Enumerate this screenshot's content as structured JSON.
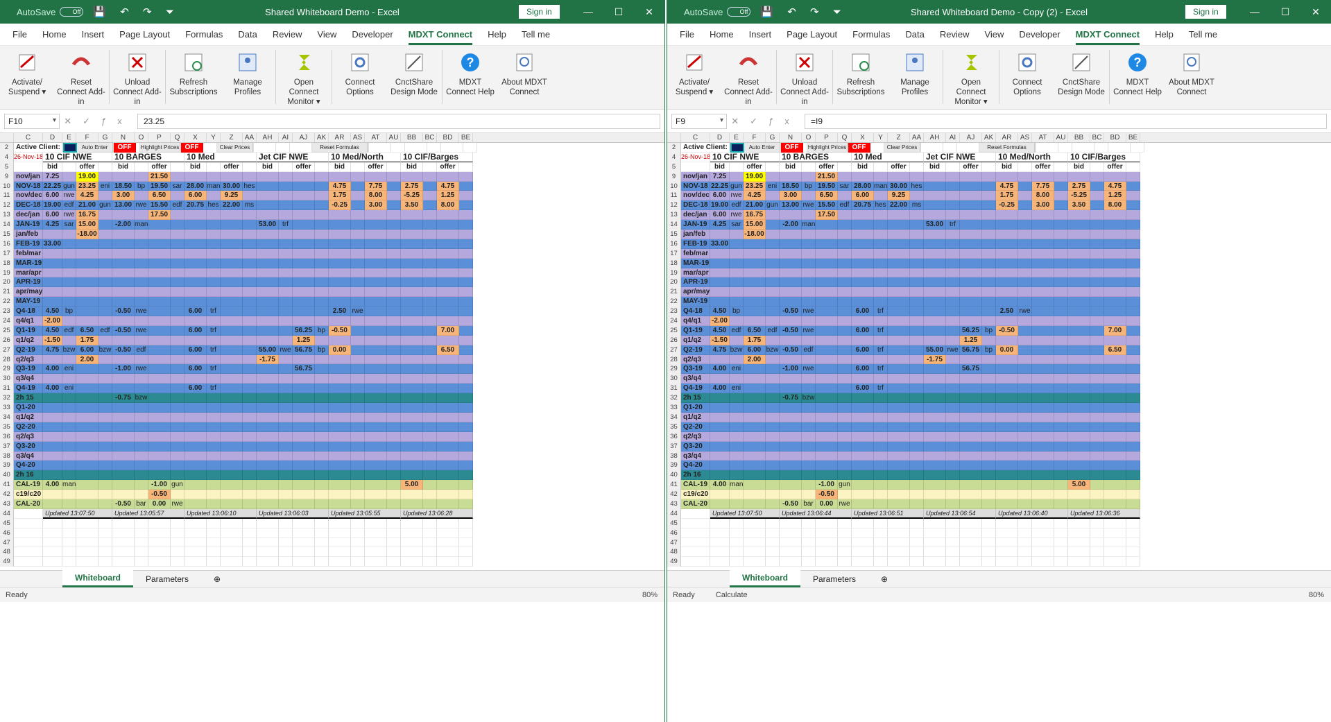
{
  "left": {
    "autosave": "AutoSave",
    "toggle": "Off",
    "title": "Shared Whiteboard Demo  -  Excel",
    "signin": "Sign in",
    "menu": [
      "File",
      "Home",
      "Insert",
      "Page Layout",
      "Formulas",
      "Data",
      "Review",
      "View",
      "Developer",
      "MDXT Connect",
      "Help",
      "Tell me"
    ],
    "namebox": "F10",
    "formula": "23.25",
    "status": "Ready",
    "zoom": "80%"
  },
  "right": {
    "autosave": "AutoSave",
    "toggle": "Off",
    "title": "Shared Whiteboard Demo - Copy (2)  -  Excel",
    "signin": "Sign in",
    "menu": [
      "File",
      "Home",
      "Insert",
      "Page Layout",
      "Formulas",
      "Data",
      "Review",
      "View",
      "Developer",
      "MDXT Connect",
      "Help",
      "Tell me"
    ],
    "namebox": "F9",
    "formula": "=I9",
    "status": "Ready",
    "status2": "Calculate",
    "zoom": "80%"
  },
  "ribbon": [
    {
      "label": "Activate/ Suspend ▾",
      "icon": "activate-icon"
    },
    {
      "label": "Reset Connect Add-in",
      "icon": "reset-icon"
    },
    {
      "label": "Unload Connect Add-in",
      "icon": "unload-icon"
    },
    {
      "label": "Refresh Subscriptions",
      "icon": "refresh-icon"
    },
    {
      "label": "Manage Profiles",
      "icon": "profiles-icon"
    },
    {
      "label": "Open Connect Monitor ▾",
      "icon": "monitor-icon"
    },
    {
      "label": "Connect Options",
      "icon": "options-icon"
    },
    {
      "label": "CnctShare Design Mode",
      "icon": "design-icon"
    },
    {
      "label": "MDXT Connect Help",
      "icon": "help-icon"
    },
    {
      "label": "About MDXT Connect",
      "icon": "about-icon"
    }
  ],
  "columns": [
    "C",
    "D",
    "E",
    "F",
    "G",
    "N",
    "O",
    "P",
    "Q",
    "X",
    "Y",
    "Z",
    "AA",
    "AH",
    "AI",
    "AJ",
    "AK",
    "AR",
    "AS",
    "AT",
    "AU",
    "BB",
    "BC",
    "BD",
    "BE"
  ],
  "controls": {
    "active_client": "Active Client:",
    "auto_enter": "Auto Enter",
    "off": "OFF",
    "highlight": "Highlight Prices",
    "clear": "Clear Prices",
    "reset": "Reset Formulas"
  },
  "date": "26-Nov-18",
  "groups": [
    "10 CIF NWE",
    "10 BARGES",
    "10 Med",
    "Jet CIF NWE",
    "10 Med/North",
    "10 CIF/Barges"
  ],
  "bid": "bid",
  "offer": "offer",
  "rows": [
    {
      "n": "9",
      "label": "nov/jan",
      "cells": [
        "7.25",
        "",
        "19.00",
        "",
        "",
        "",
        "21.50",
        "",
        "",
        "",
        "",
        "",
        "",
        "",
        "",
        "",
        "",
        "",
        "",
        "",
        "",
        "",
        "",
        ""
      ]
    },
    {
      "n": "10",
      "label": "NOV-18",
      "cells": [
        "22.25",
        "gun",
        "23.25",
        "eni",
        "18.50",
        "bp",
        "19.50",
        "sar",
        "28.00",
        "man",
        "30.00",
        "hes",
        "",
        "",
        "",
        "",
        "4.75",
        "",
        "7.75",
        "",
        "2.75",
        "",
        "4.75",
        ""
      ]
    },
    {
      "n": "11",
      "label": "nov/dec",
      "cells": [
        "6.00",
        "rwe",
        "4.25",
        "",
        "3.00",
        "",
        "6.50",
        "",
        "6.00",
        "",
        "9.25",
        "",
        "",
        "",
        "",
        "",
        "1.75",
        "",
        "8.00",
        "",
        "-5.25",
        "",
        "1.25",
        ""
      ]
    },
    {
      "n": "12",
      "label": "DEC-18",
      "cells": [
        "19.00",
        "edf",
        "21.00",
        "gun",
        "13.00",
        "rwe",
        "15.50",
        "edf",
        "20.75",
        "hes",
        "22.00",
        "ms",
        "",
        "",
        "",
        "",
        "-0.25",
        "",
        "3.00",
        "",
        "3.50",
        "",
        "8.00",
        ""
      ]
    },
    {
      "n": "13",
      "label": "dec/jan",
      "cells": [
        "6.00",
        "rwe",
        "16.75",
        "",
        "",
        "",
        "17.50",
        "",
        "",
        "",
        "",
        "",
        "",
        "",
        "",
        "",
        "",
        "",
        "",
        "",
        "",
        "",
        "",
        ""
      ]
    },
    {
      "n": "14",
      "label": "JAN-19",
      "cells": [
        "4.25",
        "sar",
        "15.00",
        "",
        "-2.00",
        "man",
        "",
        "",
        "",
        "",
        "",
        "",
        "53.00",
        "trf",
        "",
        "",
        "",
        "",
        "",
        "",
        "",
        "",
        "",
        ""
      ]
    },
    {
      "n": "15",
      "label": "jan/feb",
      "cells": [
        "",
        "",
        "-18.00",
        "",
        "",
        "",
        "",
        "",
        "",
        "",
        "",
        "",
        "",
        "",
        "",
        "",
        "",
        "",
        "",
        "",
        "",
        "",
        "",
        ""
      ]
    },
    {
      "n": "16",
      "label": "FEB-19",
      "cells": [
        "33.00",
        "",
        "",
        "",
        "",
        "",
        "",
        "",
        "",
        "",
        "",
        "",
        "",
        "",
        "",
        "",
        "",
        "",
        "",
        "",
        "",
        "",
        "",
        ""
      ]
    },
    {
      "n": "17",
      "label": "feb/mar",
      "cells": []
    },
    {
      "n": "18",
      "label": "MAR-19",
      "cells": []
    },
    {
      "n": "19",
      "label": "mar/apr",
      "cells": []
    },
    {
      "n": "20",
      "label": "APR-19",
      "cells": []
    },
    {
      "n": "21",
      "label": "apr/may",
      "cells": []
    },
    {
      "n": "22",
      "label": "MAY-19",
      "cells": []
    },
    {
      "n": "23",
      "label": "Q4-18",
      "cells": [
        "4.50",
        "bp",
        "",
        "",
        "-0.50",
        "rwe",
        "",
        "",
        "6.00",
        "trf",
        "",
        "",
        "",
        "",
        "",
        "",
        "2.50",
        "rwe",
        "",
        "",
        "",
        "",
        "",
        ""
      ]
    },
    {
      "n": "24",
      "label": "q4/q1",
      "cells": [
        "-2.00",
        "",
        "",
        "",
        "",
        "",
        "",
        "",
        "",
        "",
        "",
        "",
        "",
        "",
        "",
        "",
        "",
        "",
        "",
        "",
        "",
        "",
        "",
        ""
      ]
    },
    {
      "n": "25",
      "label": "Q1-19",
      "cells": [
        "4.50",
        "edf",
        "6.50",
        "edf",
        "-0.50",
        "rwe",
        "",
        "",
        "6.00",
        "trf",
        "",
        "",
        "",
        "",
        "56.25",
        "bp",
        "-0.50",
        "",
        "",
        "",
        "",
        "",
        "7.00",
        ""
      ]
    },
    {
      "n": "26",
      "label": "q1/q2",
      "cells": [
        "-1.50",
        "",
        "1.75",
        "",
        "",
        "",
        "",
        "",
        "",
        "",
        "",
        "",
        "",
        "",
        "1.25",
        "",
        "",
        "",
        "",
        "",
        "",
        "",
        "",
        ""
      ]
    },
    {
      "n": "27",
      "label": "Q2-19",
      "cells": [
        "4.75",
        "bzw",
        "6.00",
        "bzw",
        "-0.50",
        "edf",
        "",
        "",
        "6.00",
        "trf",
        "",
        "",
        "55.00",
        "rwe",
        "56.75",
        "bp",
        "0.00",
        "",
        "",
        "",
        "",
        "",
        "6.50",
        ""
      ]
    },
    {
      "n": "28",
      "label": "q2/q3",
      "cells": [
        "",
        "",
        "2.00",
        "",
        "",
        "",
        "",
        "",
        "",
        "",
        "",
        "",
        "-1.75",
        "",
        "",
        "",
        "",
        "",
        "",
        "",
        "",
        "",
        "",
        ""
      ]
    },
    {
      "n": "29",
      "label": "Q3-19",
      "cells": [
        "4.00",
        "eni",
        "",
        "",
        "-1.00",
        "rwe",
        "",
        "",
        "6.00",
        "trf",
        "",
        "",
        "",
        "",
        "56.75",
        "",
        "",
        "",
        "",
        "",
        "",
        "",
        "",
        ""
      ]
    },
    {
      "n": "30",
      "label": "q3/q4",
      "cells": []
    },
    {
      "n": "31",
      "label": "Q4-19",
      "cells": [
        "4.00",
        "eni",
        "",
        "",
        "",
        "",
        "",
        "",
        "6.00",
        "trf",
        "",
        "",
        "",
        "",
        "",
        "",
        "",
        "",
        "",
        "",
        "",
        "",
        "",
        ""
      ]
    },
    {
      "n": "32",
      "label": "2h 15",
      "cells": [
        "",
        "",
        "",
        "",
        "-0.75",
        "bzw",
        "",
        "",
        "",
        "",
        "",
        "",
        "",
        "",
        "",
        "",
        "",
        "",
        "",
        "",
        "",
        "",
        "",
        ""
      ]
    },
    {
      "n": "33",
      "label": "Q1-20",
      "cells": []
    },
    {
      "n": "34",
      "label": "q1/q2",
      "cells": []
    },
    {
      "n": "35",
      "label": "Q2-20",
      "cells": []
    },
    {
      "n": "36",
      "label": "q2/q3",
      "cells": []
    },
    {
      "n": "37",
      "label": "Q3-20",
      "cells": []
    },
    {
      "n": "38",
      "label": "q3/q4",
      "cells": []
    },
    {
      "n": "39",
      "label": "Q4-20",
      "cells": []
    },
    {
      "n": "40",
      "label": "2h 16",
      "cells": []
    },
    {
      "n": "41",
      "label": "CAL-19",
      "cells": [
        "4.00",
        "man",
        "",
        "",
        "",
        "",
        "-1.00",
        "gun",
        "",
        "",
        "",
        "",
        "",
        "",
        "",
        "",
        "",
        "",
        "",
        "",
        "5.00",
        "",
        "",
        ""
      ]
    },
    {
      "n": "42",
      "label": "c19/c20",
      "cells": [
        "",
        "",
        "",
        "",
        "",
        "",
        "-0.50",
        "",
        "",
        "",
        "",
        "",
        "",
        "",
        "",
        "",
        "",
        "",
        "",
        "",
        "",
        "",
        "",
        ""
      ]
    },
    {
      "n": "43",
      "label": "CAL-20",
      "cells": [
        "",
        "",
        "",
        "",
        "-0.50",
        "bar",
        "0.00",
        "rwe",
        "",
        "",
        "",
        "",
        "",
        "",
        "",
        "",
        "",
        "",
        "",
        "",
        "",
        "",
        "",
        ""
      ]
    }
  ],
  "updated_left": [
    "Updated 13:07:50",
    "Updated 13:05:57",
    "Updated 13:06:10",
    "Updated 13:06:03",
    "Updated 13:05:55",
    "Updated 13:06:28"
  ],
  "updated_right": [
    "Updated 13:07:50",
    "Updated 13:06:44",
    "Updated 13:06:51",
    "Updated 13:06:54",
    "Updated 13:06:40",
    "Updated 13:06:36"
  ],
  "tabs": [
    "Whiteboard",
    "Parameters"
  ],
  "colors": {
    "accent": "#217346",
    "blue": "#5b8fd8",
    "lavender": "#b4a8dc",
    "teal": "#2b8a92",
    "green": "#c9dc95",
    "cream": "#fbf4c2",
    "orange": "#f7b57a",
    "yellow": "#ffff00",
    "red": "#ff0000"
  }
}
